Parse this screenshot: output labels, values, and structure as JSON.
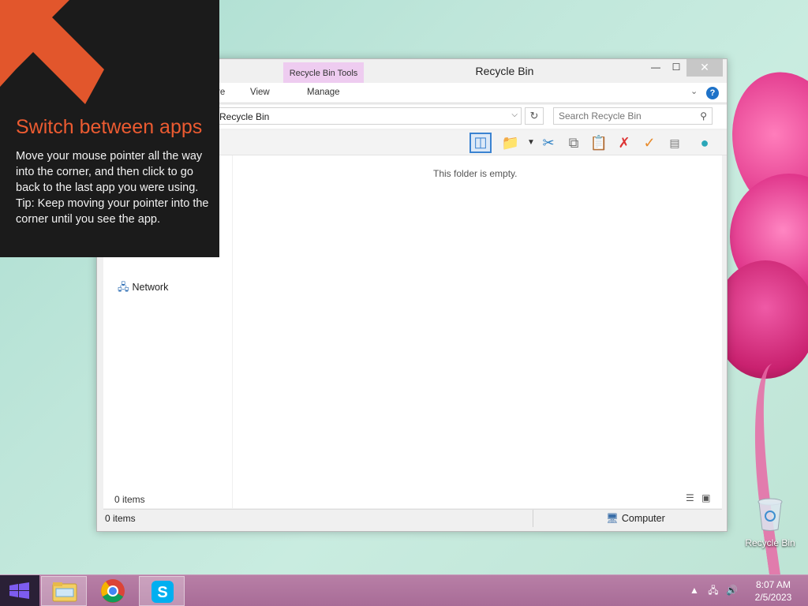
{
  "window": {
    "title": "Recycle Bin",
    "context_tab": "Recycle Bin Tools",
    "tabs": {
      "partial": "re",
      "view": "View",
      "manage": "Manage"
    },
    "controls": {
      "minimize": "—",
      "maximize": "☐",
      "close": "✕"
    },
    "help": "?"
  },
  "address": {
    "path": "Recycle Bin",
    "search_placeholder": "Search Recycle Bin"
  },
  "nav": {
    "network": "Network"
  },
  "main": {
    "empty_message": "This folder is empty.",
    "item_count": "0 items"
  },
  "status": {
    "left": "0 items",
    "location": "Computer"
  },
  "tip": {
    "title": "Switch between apps",
    "body": "Move your mouse pointer all the way into the corner, and then click to go back to the last app you were using.",
    "tip": "Tip: Keep moving your pointer into the corner until you see the app."
  },
  "desktop": {
    "recycle_bin_label": "Recycle Bin"
  },
  "taskbar": {
    "time": "8:07 AM",
    "date": "2/5/2023"
  },
  "colors": {
    "accent": "#ec5b31",
    "context_tab": "#eeccf0",
    "taskbar": "#a86c97"
  }
}
